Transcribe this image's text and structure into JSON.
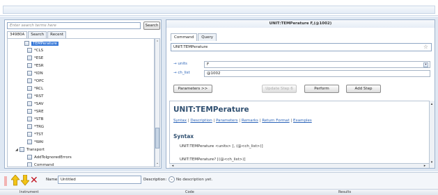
{
  "search": {
    "placeholder": "Enter search terms here",
    "button_label": "Search"
  },
  "left_tabs": [
    "34980A",
    "Search",
    "Recent"
  ],
  "tree": {
    "items": [
      {
        "label": "TEMPerature",
        "selected": true,
        "kind": "leaf"
      },
      {
        "label": "*CLS",
        "kind": "leaf"
      },
      {
        "label": "*ESE",
        "kind": "leaf"
      },
      {
        "label": "*ESR",
        "kind": "leaf"
      },
      {
        "label": "*IDN",
        "kind": "leaf"
      },
      {
        "label": "*OPC",
        "kind": "leaf"
      },
      {
        "label": "*RCL",
        "kind": "leaf"
      },
      {
        "label": "*RST",
        "kind": "leaf"
      },
      {
        "label": "*SAV",
        "kind": "leaf"
      },
      {
        "label": "*SRE",
        "kind": "leaf"
      },
      {
        "label": "*STB",
        "kind": "leaf"
      },
      {
        "label": "*TRG",
        "kind": "leaf"
      },
      {
        "label": "*TST",
        "kind": "leaf"
      },
      {
        "label": "*WAI",
        "kind": "leaf"
      },
      {
        "label": "Transport",
        "kind": "folder"
      },
      {
        "label": "AddToIgnoredErrors",
        "kind": "leaf"
      },
      {
        "label": "Command",
        "kind": "leaf"
      }
    ]
  },
  "right": {
    "title": "UNIT:TEMPerature F,(@1002)",
    "tabs": [
      "Command",
      "Query"
    ],
    "command_value": "UNIT:TEMPerature",
    "params": [
      {
        "name": "units",
        "value": "F"
      },
      {
        "name": "ch_list",
        "value": "@1002"
      }
    ],
    "buttons": {
      "parameters": "Parameters >>",
      "update_step": "Update Step 6",
      "perform": "Perform",
      "add_step": "Add Step"
    },
    "doc": {
      "title": "UNIT:TEMPerature",
      "links": [
        "Syntax",
        "Description",
        "Parameters",
        "Remarks",
        "Return Format",
        "Examples"
      ],
      "section": "Syntax",
      "lines": [
        "UNIT:TEMPerature <units> [, (@<ch_list>)]",
        "UNIT:TEMPerature? [(@<ch_list>)]"
      ]
    }
  },
  "bottom": {
    "name_label": "Name:",
    "name_value": "Untitled",
    "desc_label": "Description:",
    "desc_value": "No description yet."
  },
  "grid_headers": [
    "Instrument",
    "Code",
    "Results"
  ]
}
